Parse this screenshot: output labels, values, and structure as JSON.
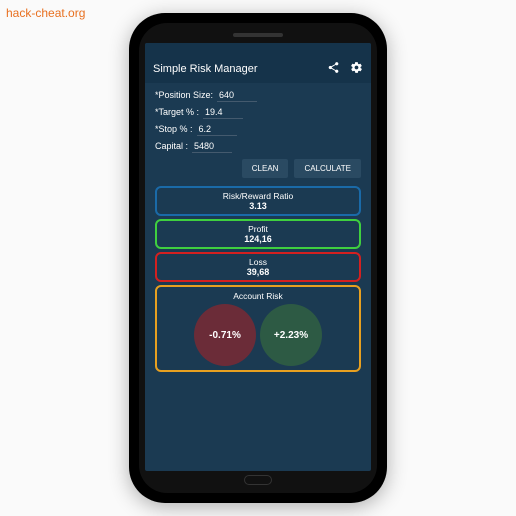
{
  "watermark": "hack-cheat.org",
  "app": {
    "title": "Simple Risk Manager"
  },
  "form": {
    "position_size": {
      "label": "*Position Size:",
      "value": "640"
    },
    "target": {
      "label": "*Target % :",
      "value": "19.4"
    },
    "stop": {
      "label": "*Stop % :",
      "value": "6.2"
    },
    "capital": {
      "label": "Capital :",
      "value": "5480"
    }
  },
  "buttons": {
    "clean": "CLEAN",
    "calculate": "CALCULATE"
  },
  "results": {
    "ratio": {
      "title": "Risk/Reward Ratio",
      "value": "3.13"
    },
    "profit": {
      "title": "Profit",
      "value": "124,16"
    },
    "loss": {
      "title": "Loss",
      "value": "39,68"
    },
    "account_risk": {
      "title": "Account Risk",
      "negative": "-0.71%",
      "positive": "+2.23%"
    }
  }
}
